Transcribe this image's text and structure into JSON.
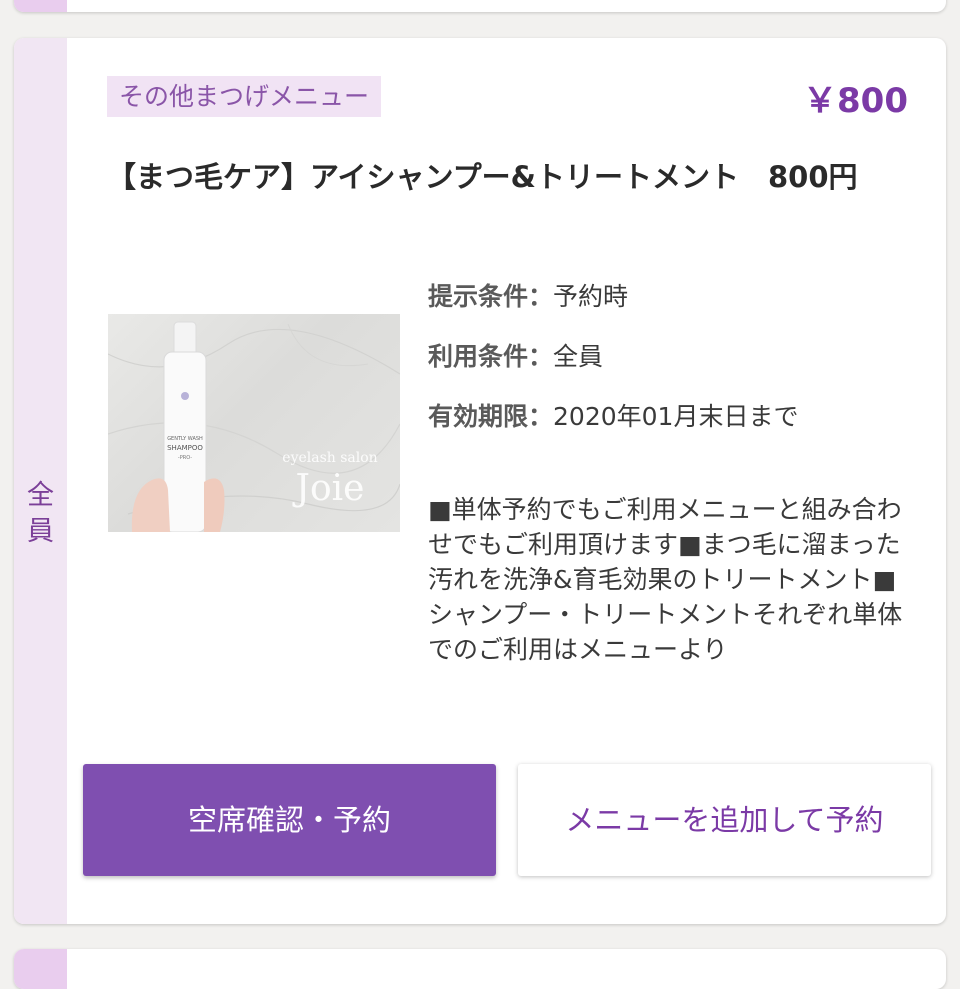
{
  "coupon": {
    "target_label": "全員",
    "category": "その他まつげメニュー",
    "price": "￥800",
    "title": "【まつ毛ケア】アイシャンプー&トリートメント　800円",
    "conditions": [
      {
        "label": "提示条件：",
        "value": "予約時"
      },
      {
        "label": "利用条件：",
        "value": "全員"
      },
      {
        "label": "有効期限：",
        "value": "2020年01月末日まで"
      }
    ],
    "description": "■単体予約でもご利用メニューと組み合わせでもご利用頂けます■まつ毛に溜まった汚れを洗浄&育毛効果のトリートメント■シャンプー・トリートメントそれぞれ単体でのご利用はメニューより",
    "photo": {
      "bottle_text_1": "GENTLY WASH",
      "bottle_text_2": "SHAMPOO",
      "bottle_text_3": "-PRO-",
      "watermark_small": "eyelash salon",
      "watermark_large": "Joie"
    },
    "buttons": {
      "reserve": "空席確認・予約",
      "add_menu": "メニューを追加して予約"
    }
  },
  "colors": {
    "accent": "#7f4fb0",
    "price": "#7b3aa6",
    "tag_bg": "#f1e3f4",
    "strip_bg": "#f1e6f3"
  }
}
